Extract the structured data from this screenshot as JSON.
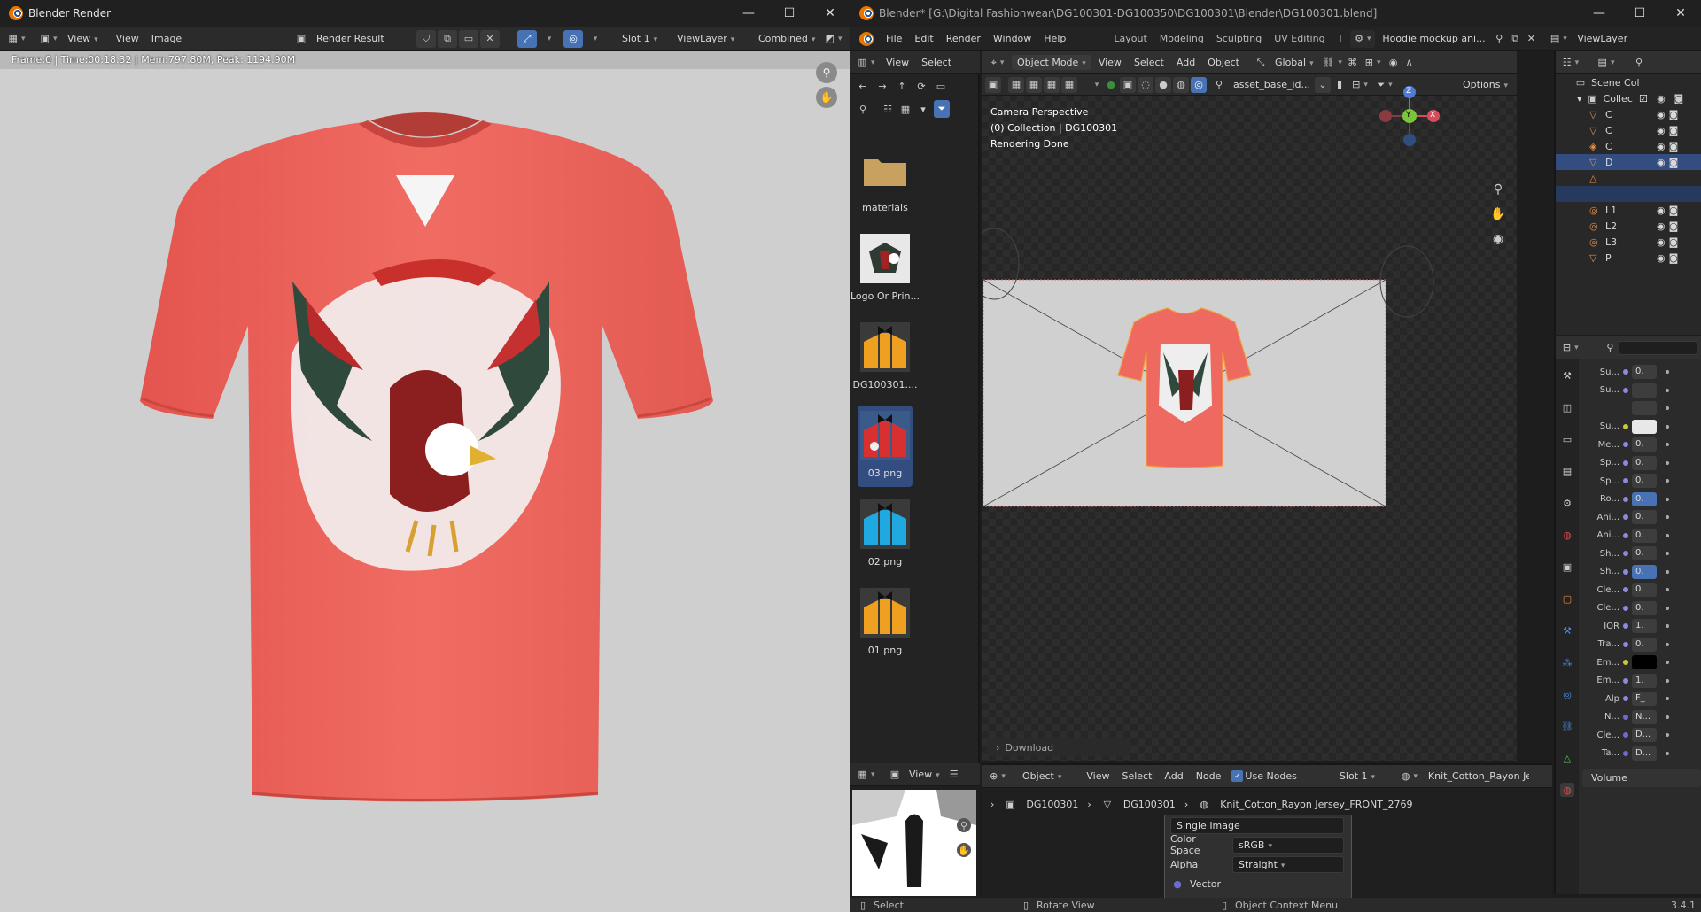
{
  "render_window": {
    "title": "Blender Render",
    "header": {
      "view": "View",
      "view2": "View",
      "image": "Image",
      "image_name": "Render Result",
      "slot": "Slot 1",
      "view_layer": "ViewLayer",
      "pass": "Combined"
    },
    "info": "Frame:0 | Time:00:18.32 | Mem:797.80M, Peak: 1194.90M"
  },
  "main_window": {
    "title": "Blender* [G:\\Digital Fashionwear\\DG100301-DG100350\\DG100301\\Blender\\DG100301.blend]",
    "menu": [
      "File",
      "Edit",
      "Render",
      "Window",
      "Help"
    ],
    "workspaces": [
      "Layout",
      "Modeling",
      "Sculpting",
      "UV Editing",
      "T"
    ],
    "scene_name": "Hoodie mockup ani...",
    "view_layer": "ViewLayer",
    "asset_browser": {
      "view": "View",
      "select": "Select",
      "search": "asset_base_id...",
      "options": "Options",
      "items": [
        {
          "label": "materials",
          "kind": "folder"
        },
        {
          "label": "Logo Or Prin...",
          "kind": "logo"
        },
        {
          "label": "DG100301....",
          "kind": "orange"
        },
        {
          "label": "03.png",
          "kind": "red",
          "selected": true
        },
        {
          "label": "02.png",
          "kind": "blue"
        },
        {
          "label": "01.png",
          "kind": "orange"
        }
      ]
    },
    "viewport": {
      "mode": "Object Mode",
      "menu": [
        "View",
        "Select",
        "Add",
        "Object"
      ],
      "transform": "Global",
      "overlay_lines": [
        "Camera Perspective",
        "(0) Collection | DG100301",
        "Rendering Done"
      ],
      "download": "Download",
      "gizmo": {
        "z": "Z",
        "y": "Y",
        "x": "X"
      }
    },
    "outliner": {
      "scene": "Scene Col",
      "collection": "Collec",
      "rows": [
        "C",
        "C",
        "C",
        "D",
        "",
        "",
        "L1",
        "L2",
        "L3",
        "P"
      ]
    },
    "properties": {
      "rows": [
        {
          "label": "Su...",
          "value": "0.",
          "dot": "#8a8ae0"
        },
        {
          "label": "Su...",
          "value": "",
          "dot": "#8a8ae0",
          "swatch": "#3d3d3d"
        },
        {
          "label": "",
          "value": "",
          "dot": "",
          "swatch": "#3d3d3d"
        },
        {
          "label": "Su...",
          "value": "",
          "dot": "#c8c838",
          "swatch": "#e8e8e8"
        },
        {
          "label": "Me...",
          "value": "0.",
          "dot": "#8a8ae0"
        },
        {
          "label": "Sp...",
          "value": "0.",
          "dot": "#8a8ae0"
        },
        {
          "label": "Sp...",
          "value": "0.",
          "dot": "#8a8ae0"
        },
        {
          "label": "Ro...",
          "value": "0.",
          "dot": "#8a8ae0",
          "active": true
        },
        {
          "label": "Ani...",
          "value": "0.",
          "dot": "#8a8ae0"
        },
        {
          "label": "Ani...",
          "value": "0.",
          "dot": "#8a8ae0"
        },
        {
          "label": "Sh...",
          "value": "0.",
          "dot": "#8a8ae0"
        },
        {
          "label": "Sh...",
          "value": "0.",
          "dot": "#8a8ae0",
          "active": true
        },
        {
          "label": "Cle...",
          "value": "0.",
          "dot": "#8a8ae0"
        },
        {
          "label": "Cle...",
          "value": "0.",
          "dot": "#8a8ae0"
        },
        {
          "label": "IOR",
          "value": "1.",
          "dot": "#8a8ae0"
        },
        {
          "label": "Tra...",
          "value": "0.",
          "dot": "#8a8ae0"
        },
        {
          "label": "Em...",
          "value": "",
          "dot": "#c8c838",
          "swatch": "#000000"
        },
        {
          "label": "Em...",
          "value": "1.",
          "dot": "#8a8ae0"
        },
        {
          "label": "Alp",
          "value": "F_",
          "dot": "#8a8ae0",
          "arrow": true
        },
        {
          "label": "N...",
          "value": "N...",
          "dot": "#6c6cd0",
          "arrow": true
        },
        {
          "label": "Cle...",
          "value": "D...",
          "dot": "#6c6cd0"
        },
        {
          "label": "Ta...",
          "value": "D...",
          "dot": "#6c6cd0"
        }
      ],
      "volume": "Volume"
    },
    "node_editor": {
      "view": "View",
      "object": "Object",
      "menu": [
        "View",
        "Select",
        "Add",
        "Node"
      ],
      "use_nodes": "Use Nodes",
      "slot": "Slot 1",
      "material": "Knit_Cotton_Rayon Jer",
      "breadcrumb": [
        "DG100301",
        "DG100301",
        "Knit_Cotton_Rayon Jersey_FRONT_2769"
      ],
      "node": {
        "source": "Single Image",
        "color_space_label": "Color Space",
        "color_space": "sRGB",
        "alpha_label": "Alpha",
        "alpha": "Straight",
        "vector": "Vector"
      }
    },
    "status": {
      "select": "Select",
      "rotate": "Rotate View",
      "context": "Object Context Menu",
      "version": "3.4.1"
    }
  }
}
